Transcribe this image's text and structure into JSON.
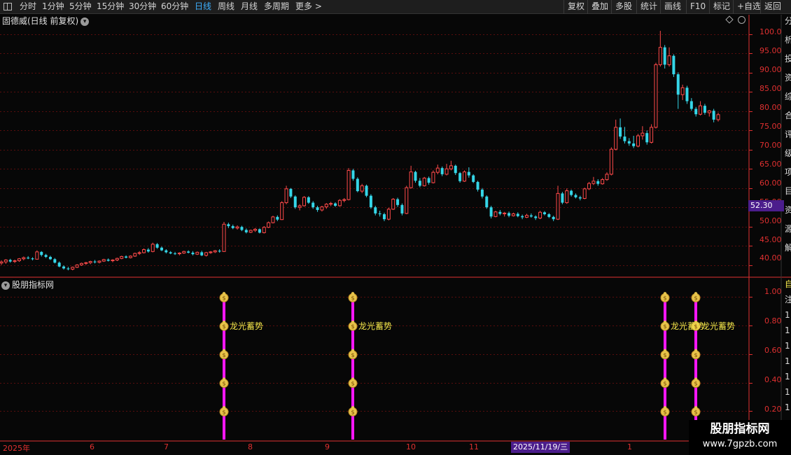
{
  "toolbar": {
    "periods": [
      "分时",
      "1分钟",
      "5分钟",
      "15分钟",
      "30分钟",
      "60分钟",
      "日线",
      "周线",
      "月线",
      "多周期",
      "更多 >"
    ],
    "active": "日线",
    "right_buttons": [
      "复权",
      "叠加",
      "多股",
      "统计",
      "画线",
      "F10",
      "标记",
      "+自选",
      "返回"
    ]
  },
  "main_chart": {
    "title": "固德威(日线 前复权)",
    "current_price_tag": "52.30",
    "y_ticks": [
      "100.0",
      "95.00",
      "90.00",
      "85.00",
      "80.00",
      "75.00",
      "70.00",
      "65.00",
      "60.00",
      "55.00",
      "50.00",
      "45.00",
      "40.00"
    ],
    "right_glyphs": [
      "分",
      "析",
      "投",
      "资",
      "综",
      "合",
      "评",
      "级",
      "项",
      "目",
      "资",
      "源",
      "解"
    ]
  },
  "indicator": {
    "title": "股朋指标网",
    "y_ticks": [
      "1.00",
      "0.80",
      "0.60",
      "0.40",
      "0.20"
    ],
    "signal_label": "龙光蓄势",
    "right_glyphs": [
      "自",
      "注",
      "1",
      "1",
      "1",
      "1",
      "1",
      "1",
      "1"
    ]
  },
  "x_axis": {
    "labels": [
      "2025年",
      "6",
      "7",
      "8",
      "9",
      "10",
      "11",
      "1"
    ],
    "cursor_date": "2025/11/19/三"
  },
  "watermark": {
    "title": "股朋指标网",
    "url": "www.7gpzb.com"
  },
  "colors": {
    "up": "#ff4a4a",
    "down": "#35d6e8",
    "signal": "#ff16ff",
    "grid": "#5a0d0d",
    "axis": "#e03030",
    "accent": "#4b1d8c"
  },
  "chart_data": {
    "type": "candlestick",
    "title": "固德威(日线 前复权)",
    "ylim": [
      37,
      102
    ],
    "ohlc": [
      [
        40.5,
        41.2,
        40.0,
        40.8
      ],
      [
        40.8,
        41.5,
        40.3,
        41.3
      ],
      [
        41.3,
        41.6,
        40.6,
        40.9
      ],
      [
        40.9,
        41.4,
        40.5,
        41.1
      ],
      [
        41.1,
        41.8,
        40.8,
        41.6
      ],
      [
        41.6,
        42.2,
        41.2,
        41.9
      ],
      [
        41.9,
        42.3,
        41.5,
        41.7
      ],
      [
        41.7,
        42.0,
        41.2,
        41.5
      ],
      [
        41.5,
        43.8,
        41.4,
        43.4
      ],
      [
        43.4,
        43.6,
        42.2,
        42.6
      ],
      [
        42.6,
        42.9,
        41.8,
        42.1
      ],
      [
        42.1,
        42.4,
        41.3,
        41.5
      ],
      [
        41.5,
        41.8,
        40.4,
        40.6
      ],
      [
        40.6,
        40.9,
        39.4,
        39.6
      ],
      [
        39.6,
        39.9,
        38.8,
        39.1
      ],
      [
        39.1,
        39.5,
        38.6,
        38.9
      ],
      [
        38.9,
        39.6,
        38.6,
        39.4
      ],
      [
        39.4,
        40.2,
        39.2,
        40.0
      ],
      [
        40.0,
        40.6,
        39.8,
        40.4
      ],
      [
        40.4,
        40.8,
        40.0,
        40.6
      ],
      [
        40.6,
        41.1,
        40.2,
        40.9
      ],
      [
        40.9,
        41.3,
        40.4,
        40.7
      ],
      [
        40.7,
        41.2,
        40.4,
        41.0
      ],
      [
        41.0,
        41.6,
        40.8,
        41.4
      ],
      [
        41.4,
        41.7,
        40.9,
        41.1
      ],
      [
        41.1,
        41.5,
        40.7,
        41.3
      ],
      [
        41.3,
        41.9,
        41.0,
        41.7
      ],
      [
        41.7,
        42.4,
        41.5,
        42.2
      ],
      [
        42.2,
        42.5,
        41.7,
        41.9
      ],
      [
        41.9,
        42.5,
        41.7,
        42.3
      ],
      [
        42.3,
        43.2,
        42.1,
        43.0
      ],
      [
        43.0,
        43.6,
        42.6,
        43.2
      ],
      [
        43.2,
        44.3,
        43.0,
        44.0
      ],
      [
        44.0,
        44.4,
        43.2,
        43.5
      ],
      [
        43.5,
        45.8,
        43.3,
        45.4
      ],
      [
        45.4,
        45.7,
        44.2,
        44.5
      ],
      [
        44.5,
        44.8,
        43.6,
        43.8
      ],
      [
        43.8,
        44.1,
        43.0,
        43.3
      ],
      [
        43.3,
        43.6,
        42.8,
        43.0
      ],
      [
        43.0,
        43.4,
        42.6,
        42.9
      ],
      [
        42.9,
        43.3,
        42.5,
        43.1
      ],
      [
        43.1,
        43.7,
        42.9,
        43.5
      ],
      [
        43.5,
        43.8,
        43.0,
        43.2
      ],
      [
        43.2,
        43.6,
        42.5,
        42.8
      ],
      [
        42.8,
        43.5,
        42.6,
        43.3
      ],
      [
        43.3,
        43.7,
        42.3,
        42.5
      ],
      [
        42.5,
        43.4,
        42.2,
        43.2
      ],
      [
        43.2,
        43.6,
        42.9,
        43.4
      ],
      [
        43.4,
        43.9,
        43.1,
        43.7
      ],
      [
        43.7,
        44.1,
        43.2,
        43.5
      ],
      [
        43.5,
        51.2,
        43.4,
        50.6
      ],
      [
        50.6,
        51.0,
        49.6,
        50.1
      ],
      [
        50.1,
        50.5,
        49.3,
        49.6
      ],
      [
        49.6,
        50.3,
        49.2,
        49.9
      ],
      [
        49.9,
        50.2,
        48.8,
        49.1
      ],
      [
        49.1,
        49.5,
        48.2,
        48.5
      ],
      [
        48.5,
        49.2,
        48.3,
        49.0
      ],
      [
        49.0,
        49.6,
        48.6,
        49.3
      ],
      [
        49.3,
        49.5,
        48.2,
        48.4
      ],
      [
        48.4,
        50.1,
        48.2,
        49.8
      ],
      [
        49.8,
        51.3,
        49.6,
        51.0
      ],
      [
        51.0,
        52.8,
        50.8,
        52.5
      ],
      [
        52.5,
        52.9,
        51.4,
        51.8
      ],
      [
        51.8,
        56.6,
        51.7,
        56.2
      ],
      [
        56.2,
        60.6,
        55.8,
        59.8
      ],
      [
        59.8,
        60.0,
        57.4,
        57.8
      ],
      [
        57.8,
        58.1,
        54.6,
        55.0
      ],
      [
        55.0,
        55.8,
        54.2,
        55.4
      ],
      [
        55.4,
        57.9,
        55.2,
        57.6
      ],
      [
        57.6,
        57.9,
        55.9,
        56.2
      ],
      [
        56.2,
        56.6,
        54.6,
        55.0
      ],
      [
        55.0,
        55.4,
        53.8,
        54.3
      ],
      [
        54.3,
        55.4,
        53.9,
        55.1
      ],
      [
        55.1,
        56.1,
        54.6,
        55.8
      ],
      [
        55.8,
        56.4,
        55.3,
        56.0
      ],
      [
        56.0,
        56.3,
        55.1,
        55.4
      ],
      [
        55.4,
        57.1,
        55.2,
        56.8
      ],
      [
        56.8,
        57.4,
        56.3,
        57.0
      ],
      [
        57.0,
        65.2,
        56.8,
        64.6
      ],
      [
        64.6,
        65.0,
        61.9,
        62.4
      ],
      [
        62.4,
        62.8,
        58.9,
        59.2
      ],
      [
        59.2,
        61.1,
        58.7,
        60.6
      ],
      [
        60.6,
        60.9,
        57.6,
        58.0
      ],
      [
        58.0,
        58.4,
        54.6,
        55.0
      ],
      [
        55.0,
        55.4,
        52.9,
        53.4
      ],
      [
        53.4,
        54.1,
        52.6,
        53.2
      ],
      [
        53.2,
        53.6,
        51.4,
        51.9
      ],
      [
        51.9,
        54.9,
        51.6,
        54.5
      ],
      [
        54.5,
        57.4,
        54.3,
        57.1
      ],
      [
        57.1,
        57.5,
        55.1,
        55.6
      ],
      [
        55.6,
        56.0,
        52.9,
        53.4
      ],
      [
        53.4,
        60.6,
        53.2,
        60.1
      ],
      [
        60.1,
        65.8,
        59.9,
        64.2
      ],
      [
        64.2,
        64.5,
        61.4,
        61.9
      ],
      [
        61.9,
        62.6,
        60.2,
        60.6
      ],
      [
        60.6,
        62.9,
        60.4,
        62.6
      ],
      [
        62.6,
        63.0,
        60.9,
        61.4
      ],
      [
        61.4,
        64.6,
        61.2,
        64.1
      ],
      [
        64.1,
        66.1,
        63.6,
        65.2
      ],
      [
        65.2,
        65.6,
        63.1,
        63.6
      ],
      [
        63.6,
        66.3,
        63.3,
        65.0
      ],
      [
        65.0,
        67.1,
        64.6,
        65.8
      ],
      [
        65.8,
        66.1,
        63.4,
        63.9
      ],
      [
        63.9,
        64.2,
        61.4,
        61.8
      ],
      [
        61.8,
        64.6,
        61.6,
        64.2
      ],
      [
        64.2,
        65.4,
        62.7,
        63.3
      ],
      [
        63.3,
        63.6,
        61.3,
        61.6
      ],
      [
        61.6,
        61.9,
        59.1,
        59.6
      ],
      [
        59.6,
        60.0,
        57.3,
        57.8
      ],
      [
        57.8,
        58.1,
        54.6,
        55.0
      ],
      [
        55.0,
        55.4,
        52.1,
        52.6
      ],
      [
        52.6,
        54.1,
        52.4,
        53.8
      ],
      [
        53.8,
        54.3,
        52.9,
        53.3
      ],
      [
        53.3,
        53.8,
        52.6,
        53.5
      ],
      [
        53.5,
        53.9,
        52.4,
        52.8
      ],
      [
        52.8,
        53.6,
        52.6,
        53.3
      ],
      [
        53.3,
        53.7,
        52.4,
        52.7
      ],
      [
        52.7,
        53.1,
        51.9,
        52.4
      ],
      [
        52.4,
        53.3,
        52.2,
        52.9
      ],
      [
        52.9,
        53.4,
        52.3,
        52.6
      ],
      [
        52.6,
        52.9,
        51.7,
        52.2
      ],
      [
        52.2,
        54.1,
        51.9,
        53.7
      ],
      [
        53.7,
        54.0,
        52.9,
        53.2
      ],
      [
        53.2,
        53.5,
        52.2,
        52.5
      ],
      [
        52.5,
        52.8,
        51.4,
        51.9
      ],
      [
        51.9,
        60.6,
        51.7,
        58.6
      ],
      [
        58.6,
        59.0,
        55.8,
        56.2
      ],
      [
        56.2,
        59.9,
        55.9,
        59.3
      ],
      [
        59.3,
        59.6,
        57.8,
        58.2
      ],
      [
        58.2,
        58.6,
        57.3,
        57.6
      ],
      [
        57.6,
        58.0,
        56.8,
        57.3
      ],
      [
        57.3,
        60.1,
        57.1,
        59.8
      ],
      [
        59.8,
        61.6,
        59.5,
        61.2
      ],
      [
        61.2,
        62.9,
        60.8,
        61.8
      ],
      [
        61.8,
        62.3,
        60.6,
        61.1
      ],
      [
        61.1,
        62.6,
        60.9,
        62.2
      ],
      [
        62.2,
        64.1,
        61.9,
        63.6
      ],
      [
        63.6,
        70.6,
        63.3,
        70.1
      ],
      [
        70.1,
        77.8,
        69.8,
        75.8
      ],
      [
        75.8,
        78.1,
        72.8,
        73.4
      ],
      [
        73.4,
        75.9,
        71.6,
        72.2
      ],
      [
        72.2,
        73.0,
        71.0,
        71.6
      ],
      [
        71.6,
        73.6,
        70.4,
        70.9
      ],
      [
        70.9,
        74.1,
        70.6,
        73.6
      ],
      [
        73.6,
        76.1,
        72.6,
        74.3
      ],
      [
        74.3,
        75.0,
        71.3,
        71.9
      ],
      [
        71.9,
        76.6,
        71.6,
        75.8
      ],
      [
        75.8,
        92.6,
        75.5,
        92.1
      ],
      [
        92.1,
        100.9,
        91.6,
        96.6
      ],
      [
        96.6,
        97.2,
        91.1,
        92.1
      ],
      [
        92.1,
        96.6,
        91.6,
        94.4
      ],
      [
        94.4,
        94.8,
        88.9,
        89.6
      ],
      [
        89.6,
        90.1,
        80.6,
        84.3
      ],
      [
        84.3,
        86.9,
        82.9,
        86.1
      ],
      [
        86.1,
        86.6,
        81.9,
        82.6
      ],
      [
        82.6,
        83.4,
        80.1,
        80.6
      ],
      [
        80.6,
        81.1,
        78.6,
        79.2
      ],
      [
        79.2,
        82.6,
        78.9,
        81.4
      ],
      [
        81.4,
        81.9,
        79.1,
        79.6
      ],
      [
        79.6,
        80.3,
        78.6,
        80.1
      ],
      [
        80.1,
        80.6,
        77.1,
        77.8
      ],
      [
        77.8,
        79.6,
        77.3,
        79.1
      ]
    ],
    "indicator_series": {
      "name": "龙光蓄势",
      "signal_bars": [
        50,
        79,
        149,
        156
      ],
      "levels": [
        1.0,
        0.8,
        0.6,
        0.4,
        0.2
      ],
      "ylim": [
        0,
        1.1
      ]
    }
  }
}
